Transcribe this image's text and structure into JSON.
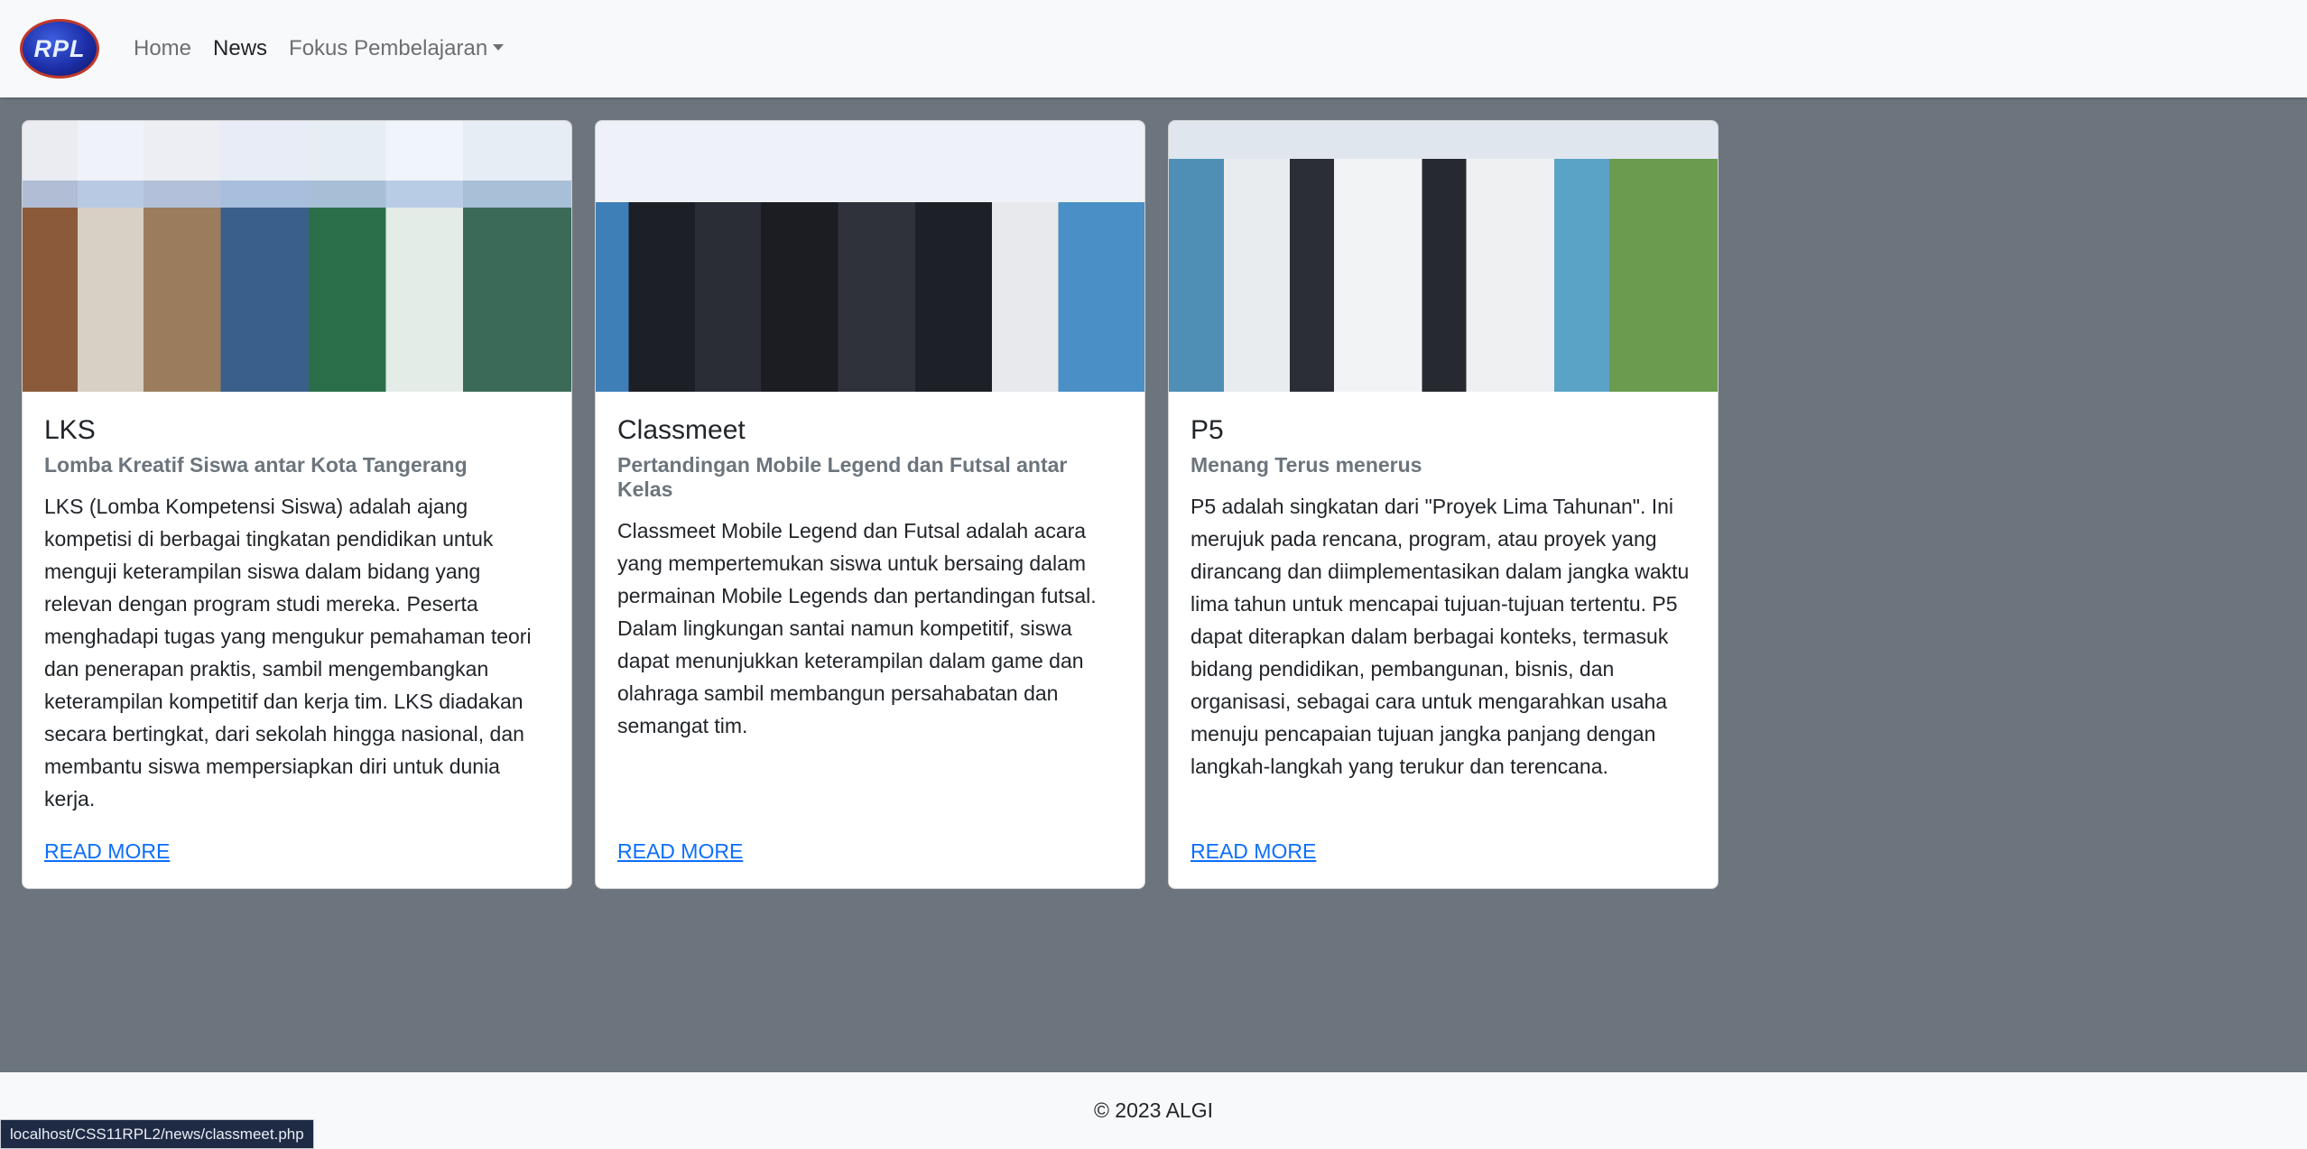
{
  "nav": {
    "logo_text": "RPL",
    "links": [
      {
        "label": "Home"
      },
      {
        "label": "News"
      },
      {
        "label": "Fokus Pembelajaran"
      }
    ]
  },
  "cards": [
    {
      "title": "LKS",
      "subtitle": "Lomba Kreatif Siswa antar Kota Tangerang",
      "text": "LKS (Lomba Kompetensi Siswa) adalah ajang kompetisi di berbagai tingkatan pendidikan untuk menguji keterampilan siswa dalam bidang yang relevan dengan program studi mereka. Peserta menghadapi tugas yang mengukur pemahaman teori dan penerapan praktis, sambil mengembangkan keterampilan kompetitif dan kerja tim. LKS diadakan secara bertingkat, dari sekolah hingga nasional, dan membantu siswa mempersiapkan diri untuk dunia kerja.",
      "link": "READ MORE"
    },
    {
      "title": "Classmeet",
      "subtitle": "Pertandingan Mobile Legend dan Futsal antar Kelas",
      "text": "Classmeet Mobile Legend dan Futsal adalah acara yang mempertemukan siswa untuk bersaing dalam permainan Mobile Legends dan pertandingan futsal. Dalam lingkungan santai namun kompetitif, siswa dapat menunjukkan keterampilan dalam game dan olahraga sambil membangun persahabatan dan semangat tim.",
      "link": "READ MORE"
    },
    {
      "title": "P5",
      "subtitle": "Menang Terus menerus",
      "text": "P5 adalah singkatan dari \"Proyek Lima Tahunan\". Ini merujuk pada rencana, program, atau proyek yang dirancang dan diimplementasikan dalam jangka waktu lima tahun untuk mencapai tujuan-tujuan tertentu. P5 dapat diterapkan dalam berbagai konteks, termasuk bidang pendidikan, pembangunan, bisnis, dan organisasi, sebagai cara untuk mengarahkan usaha menuju pencapaian tujuan jangka panjang dengan langkah-langkah yang terukur dan terencana.",
      "link": "READ MORE"
    }
  ],
  "footer": {
    "text": "© 2023 ALGI"
  },
  "status_bar": {
    "url": "localhost/CSS11RPL2/news/classmeet.php"
  }
}
